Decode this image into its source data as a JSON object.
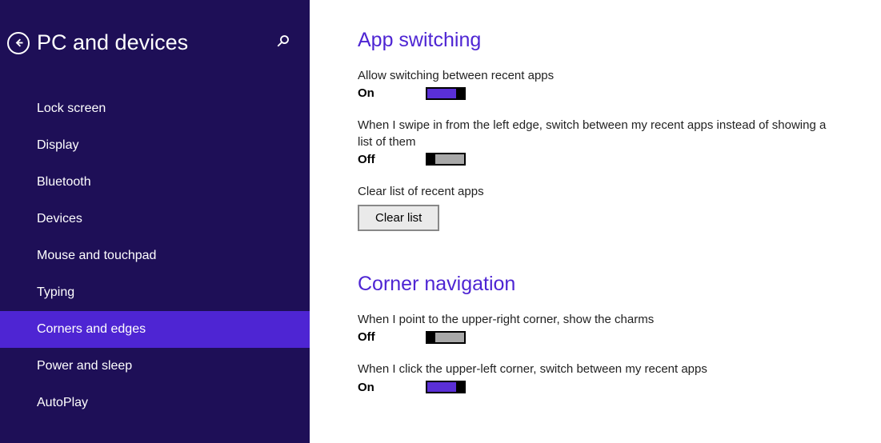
{
  "sidebar": {
    "title": "PC and devices",
    "items": [
      {
        "label": "Lock screen",
        "selected": false
      },
      {
        "label": "Display",
        "selected": false
      },
      {
        "label": "Bluetooth",
        "selected": false
      },
      {
        "label": "Devices",
        "selected": false
      },
      {
        "label": "Mouse and touchpad",
        "selected": false
      },
      {
        "label": "Typing",
        "selected": false
      },
      {
        "label": "Corners and edges",
        "selected": true
      },
      {
        "label": "Power and sleep",
        "selected": false
      },
      {
        "label": "AutoPlay",
        "selected": false
      }
    ]
  },
  "main": {
    "section1": {
      "title": "App switching",
      "setting1": {
        "label": "Allow switching between recent apps",
        "state": "On",
        "on": true
      },
      "setting2": {
        "label": "When I swipe in from the left edge, switch between my recent apps instead of showing a list of them",
        "state": "Off",
        "on": false
      },
      "setting3": {
        "label": "Clear list of recent apps",
        "button": "Clear list"
      }
    },
    "section2": {
      "title": "Corner navigation",
      "setting1": {
        "label": "When I point to the upper-right corner, show the charms",
        "state": "Off",
        "on": false
      },
      "setting2": {
        "label": "When I click the upper-left corner, switch between my recent apps",
        "state": "On",
        "on": true
      }
    }
  }
}
